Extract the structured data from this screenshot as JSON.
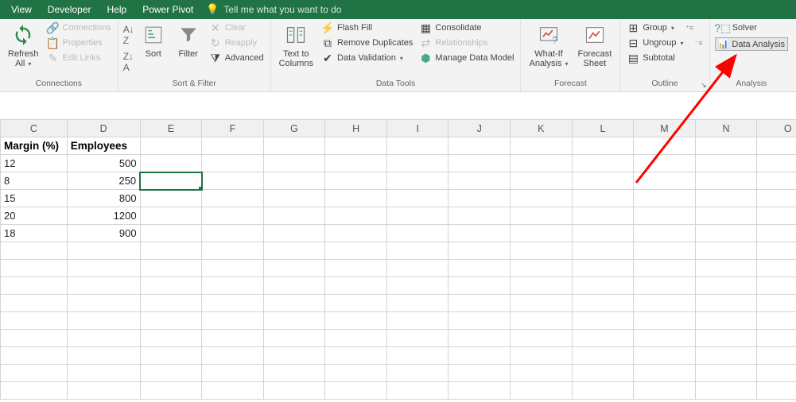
{
  "menubar": {
    "items": [
      "View",
      "Developer",
      "Help",
      "Power Pivot"
    ],
    "tellme": "Tell me what you want to do"
  },
  "ribbon": {
    "connections": {
      "refresh": "Refresh",
      "all": "All",
      "conn": "Connections",
      "prop": "Properties",
      "edit": "Edit Links",
      "label": "Connections"
    },
    "sortfilter": {
      "sort": "Sort",
      "filter": "Filter",
      "clear": "Clear",
      "reapply": "Reapply",
      "advanced": "Advanced",
      "label": "Sort & Filter"
    },
    "datatools": {
      "t2c1": "Text to",
      "t2c2": "Columns",
      "flash": "Flash Fill",
      "remdup": "Remove Duplicates",
      "dataval": "Data Validation",
      "consol": "Consolidate",
      "rel": "Relationships",
      "mdm": "Manage Data Model",
      "label": "Data Tools"
    },
    "forecast": {
      "wi1": "What-If",
      "wi2": "Analysis",
      "fs1": "Forecast",
      "fs2": "Sheet",
      "label": "Forecast"
    },
    "outline": {
      "group": "Group",
      "ungroup": "Ungroup",
      "subtotal": "Subtotal",
      "label": "Outline"
    },
    "analysis": {
      "solver": "Solver",
      "da": "Data Analysis",
      "label": "Analysis"
    }
  },
  "columns": [
    "C",
    "D",
    "E",
    "F",
    "G",
    "H",
    "I",
    "J",
    "K",
    "L",
    "M",
    "N",
    "O"
  ],
  "headers": {
    "c": "Margin (%)",
    "d": "Employees"
  },
  "rows": [
    {
      "c": "12",
      "d": "500"
    },
    {
      "c": "8",
      "d": "250"
    },
    {
      "c": "15",
      "d": "800"
    },
    {
      "c": "20",
      "d": "1200"
    },
    {
      "c": "18",
      "d": "900"
    }
  ]
}
